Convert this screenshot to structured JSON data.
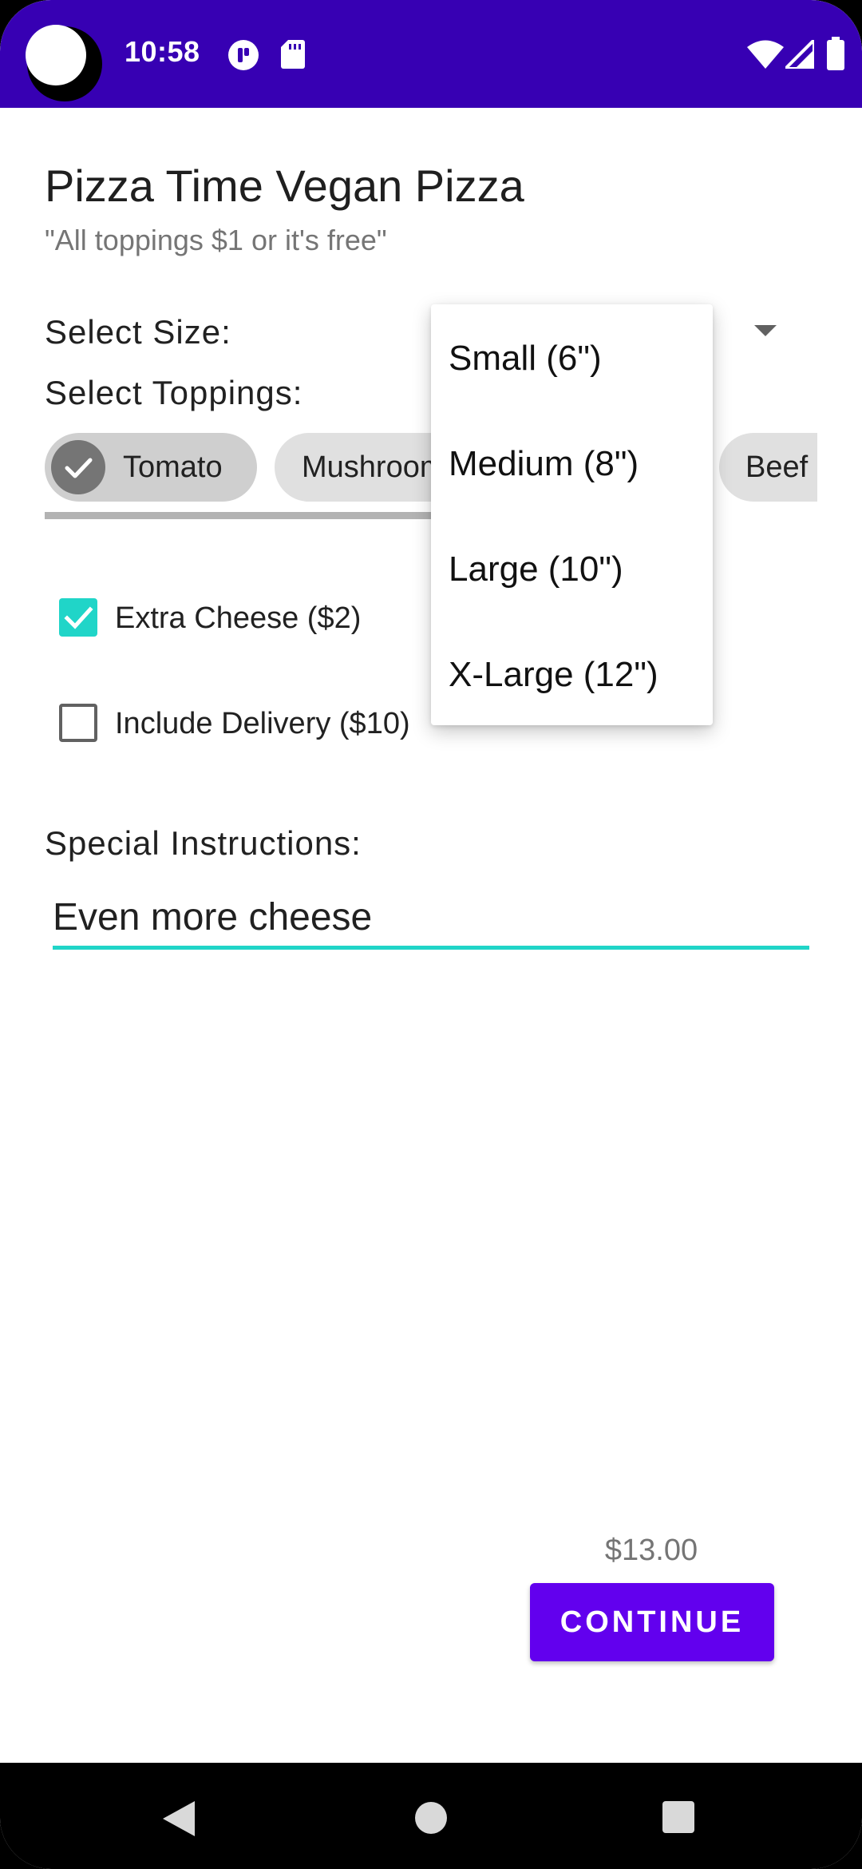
{
  "status_bar": {
    "time": "10:58",
    "icons": [
      "camera-cutout",
      "app-notification-icon",
      "sd-card-icon",
      "wifi-icon",
      "signal-icon",
      "battery-icon"
    ]
  },
  "header": {
    "title": "Pizza Time Vegan Pizza",
    "subtitle": "\"All toppings $1 or it's free\""
  },
  "size": {
    "label": "Select Size:",
    "options": [
      "Small (6\")",
      "Medium (8\")",
      "Large (10\")",
      "X-Large (12\")"
    ]
  },
  "toppings": {
    "label": "Select Toppings:",
    "chips": [
      {
        "label": "Tomato",
        "selected": true
      },
      {
        "label": "Mushrooms",
        "selected": false
      },
      {
        "label": "Beef",
        "selected": false
      }
    ]
  },
  "extras": {
    "extra_cheese": {
      "label": "Extra Cheese ($2)",
      "checked": true
    },
    "include_delivery": {
      "label": "Include Delivery ($10)",
      "checked": false
    }
  },
  "instructions": {
    "label": "Special Instructions:",
    "value": "Even more cheese"
  },
  "footer": {
    "price": "$13.00",
    "continue_label": "CONTINUE"
  },
  "colors": {
    "status_bar": "#3700b3",
    "primary": "#6200ee",
    "accent": "#20d5c8"
  }
}
